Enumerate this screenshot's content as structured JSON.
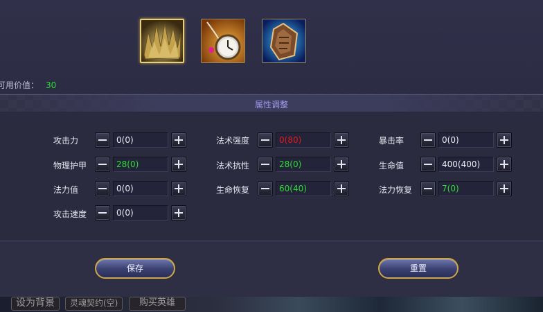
{
  "items": [
    {
      "name": "spiked-crown-icon",
      "selected": true
    },
    {
      "name": "pocket-watch-icon",
      "selected": false
    },
    {
      "name": "rune-shield-icon",
      "selected": false
    }
  ],
  "available": {
    "label": "可用价值：",
    "value": "30"
  },
  "section_title": "属性调整",
  "attributes": {
    "col1": [
      {
        "label": "攻击力",
        "value": "0(0)",
        "color": "white"
      },
      {
        "label": "物理护甲",
        "value": "28(0)",
        "color": "green"
      },
      {
        "label": "法力值",
        "value": "0(0)",
        "color": "white"
      },
      {
        "label": "攻击速度",
        "value": "0(0)",
        "color": "white"
      }
    ],
    "col2": [
      {
        "label": "法术强度",
        "value": "0(80)",
        "color": "red"
      },
      {
        "label": "法术抗性",
        "value": "28(0)",
        "color": "green"
      },
      {
        "label": "生命恢复",
        "value": "60(40)",
        "color": "green"
      }
    ],
    "col3": [
      {
        "label": "暴击率",
        "value": "0(0)",
        "color": "white"
      },
      {
        "label": "生命值",
        "value": "400(400)",
        "color": "white"
      },
      {
        "label": "法力恢复",
        "value": "7(0)",
        "color": "green"
      }
    ]
  },
  "buttons": {
    "save": "保存",
    "reset": "重置"
  },
  "background_strip": {
    "btn1": "设为背景",
    "btn2": "灵魂契约(空)",
    "btn3": "购买英雄"
  },
  "colors": {
    "green": "#2ede32",
    "red": "#e01c1c",
    "gold": "#c9a65c",
    "title": "#9f9ff0"
  }
}
